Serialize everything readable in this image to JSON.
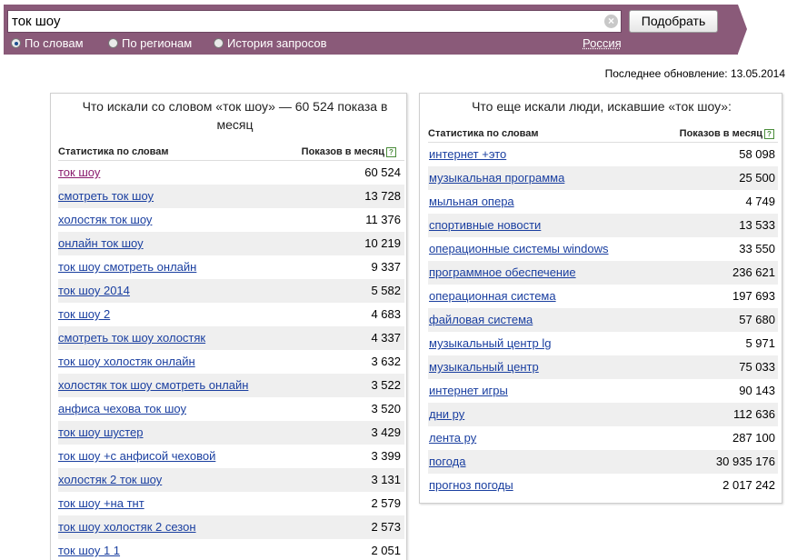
{
  "search": {
    "query": "ток шоу",
    "clear_glyph": "×",
    "submit_label": "Подобрать",
    "modes": [
      {
        "label": "По словам",
        "selected": true
      },
      {
        "label": "По регионам",
        "selected": false
      },
      {
        "label": "История запросов",
        "selected": false
      }
    ],
    "region": "Россия"
  },
  "last_update": "Последнее обновление: 13.05.2014",
  "left_panel": {
    "title": "Что искали со словом «ток шоу» — 60 524 показа в месяц",
    "col_keyword": "Статистика по словам",
    "col_count": "Показов в месяц",
    "help_glyph": "?",
    "rows": [
      {
        "keyword": "ток шоу",
        "count": "60 524"
      },
      {
        "keyword": "смотреть ток шоу",
        "count": "13 728"
      },
      {
        "keyword": "холостяк ток шоу",
        "count": "11 376"
      },
      {
        "keyword": "онлайн ток шоу",
        "count": "10 219"
      },
      {
        "keyword": "ток шоу смотреть онлайн",
        "count": "9 337"
      },
      {
        "keyword": "ток шоу 2014",
        "count": "5 582"
      },
      {
        "keyword": "ток шоу 2",
        "count": "4 683"
      },
      {
        "keyword": "смотреть ток шоу холостяк",
        "count": "4 337"
      },
      {
        "keyword": "ток шоу холостяк онлайн",
        "count": "3 632"
      },
      {
        "keyword": "холостяк ток шоу смотреть онлайн",
        "count": "3 522"
      },
      {
        "keyword": "анфиса чехова ток шоу",
        "count": "3 520"
      },
      {
        "keyword": "ток шоу шустер",
        "count": "3 429"
      },
      {
        "keyword": "ток шоу +с анфисой чеховой",
        "count": "3 399"
      },
      {
        "keyword": "холостяк 2 ток шоу",
        "count": "3 131"
      },
      {
        "keyword": "ток шоу +на тнт",
        "count": "2 579"
      },
      {
        "keyword": "ток шоу холостяк 2 сезон",
        "count": "2 573"
      },
      {
        "keyword": "ток шоу 1 1",
        "count": "2 051"
      }
    ]
  },
  "right_panel": {
    "title": "Что еще искали люди, искавшие «ток шоу»:",
    "col_keyword": "Статистика по словам",
    "col_count": "Показов в месяц",
    "help_glyph": "?",
    "rows": [
      {
        "keyword": "интернет +это",
        "count": "58 098"
      },
      {
        "keyword": "музыкальная программа",
        "count": "25 500"
      },
      {
        "keyword": "мыльная опера",
        "count": "4 749"
      },
      {
        "keyword": "спортивные новости",
        "count": "13 533"
      },
      {
        "keyword": "операционные системы windows",
        "count": "33 550"
      },
      {
        "keyword": "программное обеспечение",
        "count": "236 621"
      },
      {
        "keyword": "операционная система",
        "count": "197 693"
      },
      {
        "keyword": "файловая система",
        "count": "57 680"
      },
      {
        "keyword": "музыкальный центр lg",
        "count": "5 971"
      },
      {
        "keyword": "музыкальный центр",
        "count": "75 033"
      },
      {
        "keyword": "интернет игры",
        "count": "90 143"
      },
      {
        "keyword": "дни ру",
        "count": "112 636"
      },
      {
        "keyword": "лента ру",
        "count": "287 100"
      },
      {
        "keyword": "погода",
        "count": "30 935 176"
      },
      {
        "keyword": "прогноз погоды",
        "count": "2 017 242"
      }
    ]
  },
  "colors": {
    "header_bg": "#8a5a79",
    "link": "#1a3fa0",
    "visited_link": "#8a1c6e",
    "row_stripe": "#efefef"
  }
}
